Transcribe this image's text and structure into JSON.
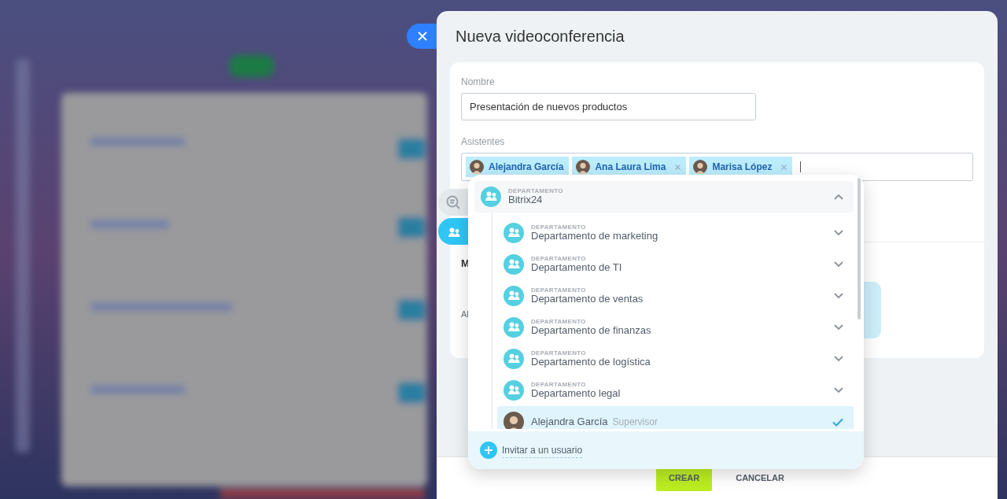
{
  "title": "Nueva videoconferencia",
  "form": {
    "name_field": {
      "label": "Nombre",
      "value": "Presentación de nuevos productos"
    },
    "attendees_field": {
      "label": "Asistentes",
      "tags": [
        {
          "name": "Alejandra García",
          "removable": false
        },
        {
          "name": "Ana Laura Lima",
          "removable": true
        },
        {
          "name": "Marisa López",
          "removable": true
        }
      ]
    },
    "partial_labels": [
      "M",
      "Al"
    ]
  },
  "side_tabs": [
    {
      "kind": "chat",
      "selected": false
    },
    {
      "kind": "people",
      "selected": true
    }
  ],
  "dropdown": {
    "items": [
      {
        "kind": "department",
        "caption": "DEPARTAMENTO",
        "name": "Bitrix24",
        "expanded": true,
        "children": [
          {
            "kind": "department",
            "caption": "DEPARTAMENTO",
            "name": "Departamento de marketing",
            "expanded": false
          },
          {
            "kind": "department",
            "caption": "DEPARTAMENTO",
            "name": "Departamento de TI",
            "expanded": false
          },
          {
            "kind": "department",
            "caption": "DEPARTAMENTO",
            "name": "Departamento de ventas",
            "expanded": false
          },
          {
            "kind": "department",
            "caption": "DEPARTAMENTO",
            "name": "Departamento de finanzas",
            "expanded": false
          },
          {
            "kind": "department",
            "caption": "DEPARTAMENTO",
            "name": "Departamento de logística",
            "expanded": false
          },
          {
            "kind": "department",
            "caption": "DEPARTAMENTO",
            "name": "Departamento legal",
            "expanded": false
          },
          {
            "kind": "user",
            "name": "Alejandra García",
            "role": "Supervisor",
            "selected": true
          }
        ]
      }
    ],
    "footer": {
      "label": "Invitar a un usuario"
    }
  },
  "buttons": [
    {
      "label": "CREAR",
      "kind": "primary"
    },
    {
      "label": "CANCELAR",
      "kind": "link"
    }
  ]
}
